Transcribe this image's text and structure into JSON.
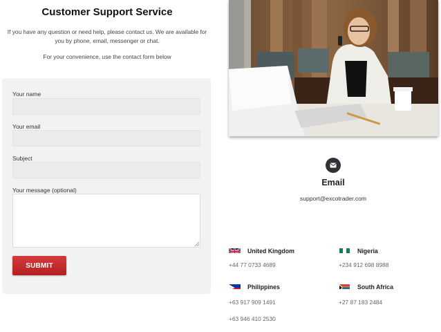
{
  "header": {
    "title": "Customer Support Service",
    "intro": "If you have any question or need help, please contact us. We are available for you by phone, email, messenger or chat.",
    "convenience": "For your convenience, use the contact form below"
  },
  "form": {
    "name_label": "Your name",
    "name_value": "",
    "email_label": "Your email",
    "email_value": "",
    "subject_label": "Subject",
    "subject_value": "",
    "message_label": "Your message (optional)",
    "message_value": "",
    "submit_label": "SUBMIT"
  },
  "contact": {
    "icon": "envelope-icon",
    "email_title": "Email",
    "email_address": "support@excotrader.com"
  },
  "offices": [
    {
      "country": "United Kingdom",
      "flag": "uk-flag-icon",
      "phones": [
        "+44 77 0733 4689"
      ]
    },
    {
      "country": "Nigeria",
      "flag": "nigeria-flag-icon",
      "phones": [
        "+234 912 698 8988"
      ]
    },
    {
      "country": "Philippines",
      "flag": "philippines-flag-icon",
      "phones": [
        "+63 917 909 1491",
        "+63 946 410 2530"
      ]
    },
    {
      "country": "South Africa",
      "flag": "south-africa-flag-icon",
      "phones": [
        "+27 87 183 2484"
      ]
    }
  ],
  "colors": {
    "submit": "#c0292b",
    "form_background": "#f2f2f2",
    "icon_dark": "#2f3236"
  }
}
